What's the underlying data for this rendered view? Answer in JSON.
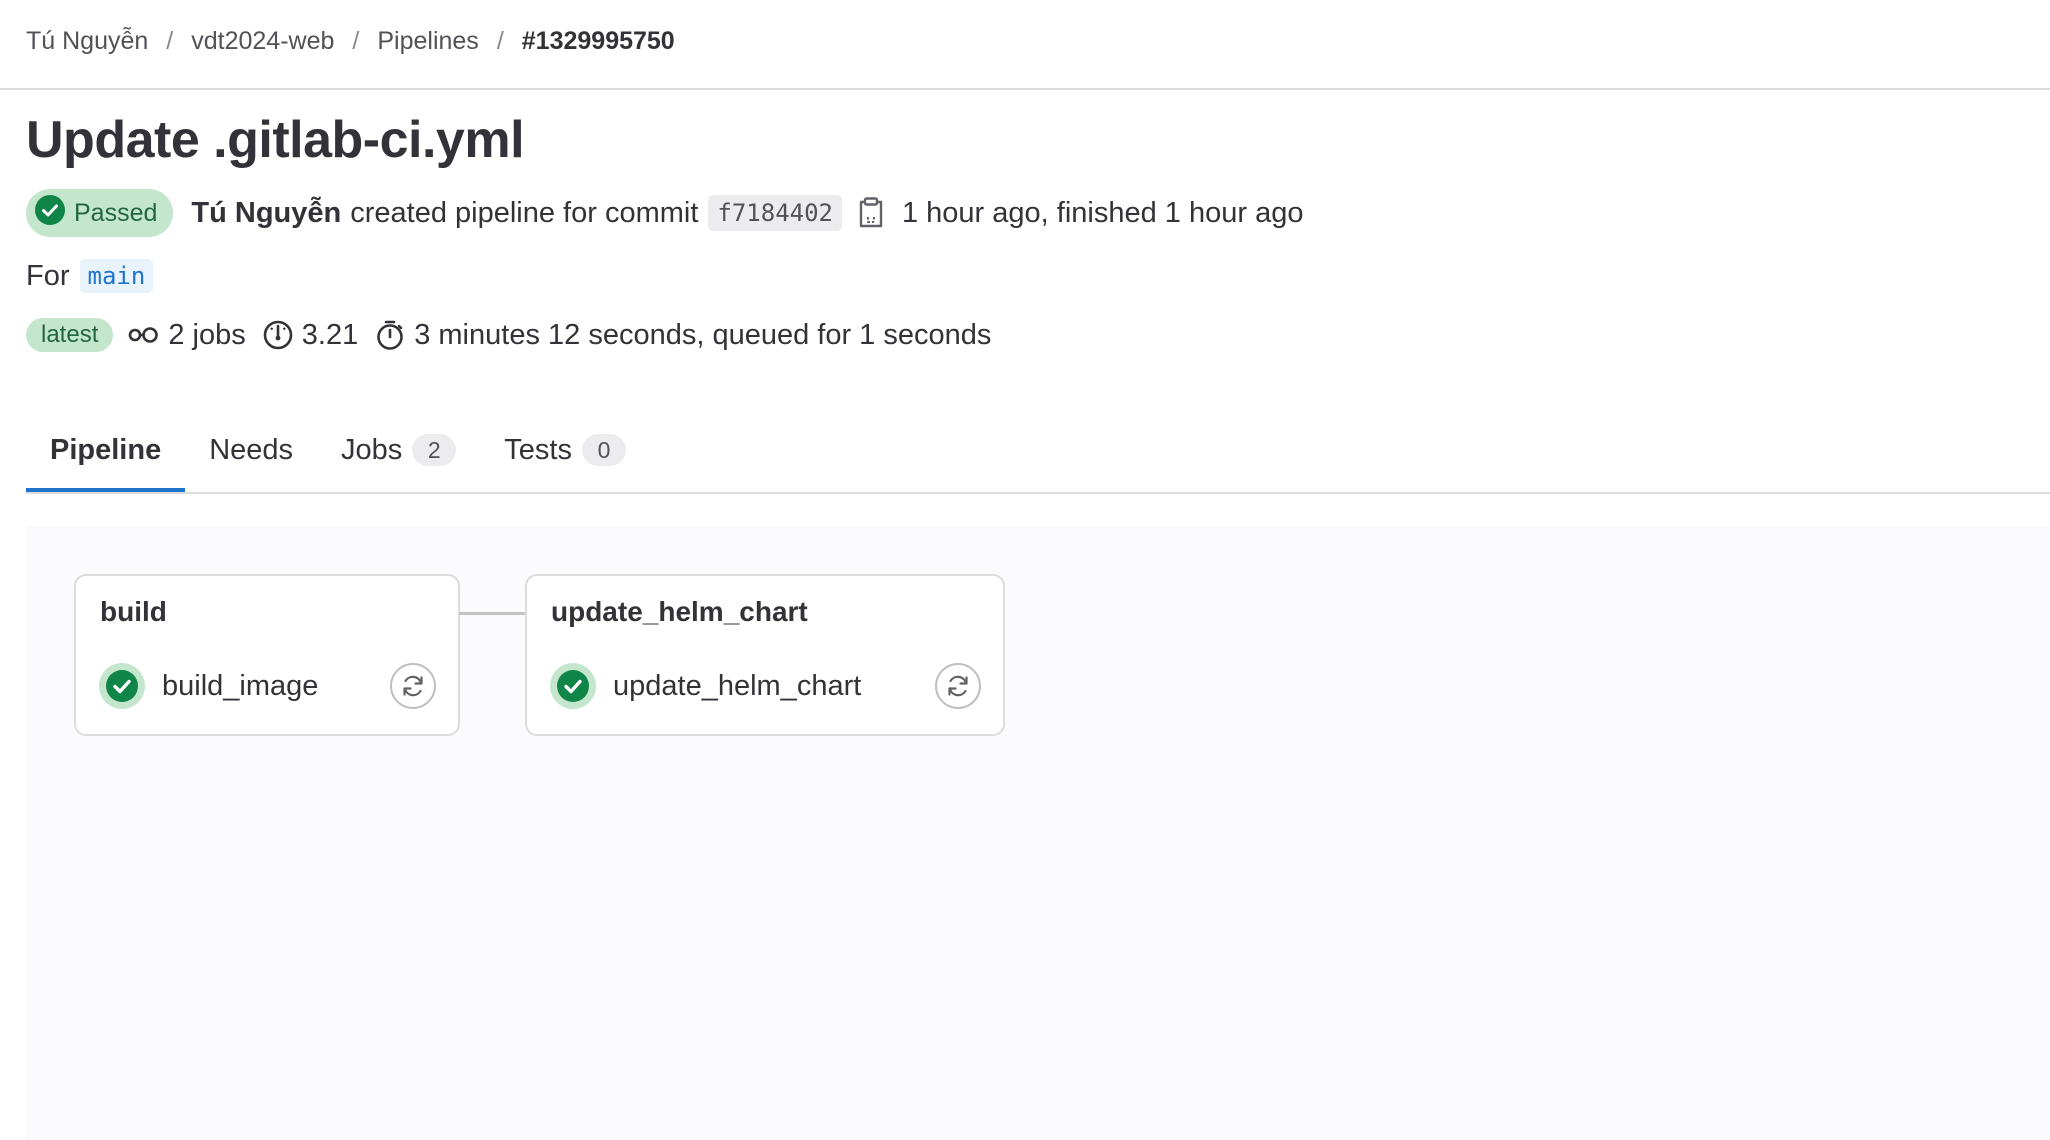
{
  "breadcrumb": {
    "items": [
      "Tú Nguyễn",
      "vdt2024-web",
      "Pipelines",
      "#1329995750"
    ],
    "separator": "/"
  },
  "title": "Update .gitlab-ci.yml",
  "status": {
    "label": "Passed",
    "icon": "check-circle-icon",
    "color": "#108548"
  },
  "author": "Tú Nguyễn",
  "created_text": "created pipeline for commit",
  "commit_sha": "f7184402",
  "time_text": "1 hour ago, finished 1 hour ago",
  "ref": {
    "label": "For",
    "branch": "main"
  },
  "meta": {
    "badge": "latest",
    "jobs": "2 jobs",
    "compute": "3.21",
    "duration": "3 minutes 12 seconds, queued for 1 seconds"
  },
  "tabs": [
    {
      "label": "Pipeline",
      "count": null,
      "active": true
    },
    {
      "label": "Needs",
      "count": null,
      "active": false
    },
    {
      "label": "Jobs",
      "count": "2",
      "active": false
    },
    {
      "label": "Tests",
      "count": "0",
      "active": false
    }
  ],
  "stages": [
    {
      "name": "build",
      "job": {
        "name": "build_image",
        "status": "success"
      }
    },
    {
      "name": "update_helm_chart",
      "job": {
        "name": "update_helm_chart",
        "status": "success"
      }
    }
  ],
  "colors": {
    "accent": "#1f75cb",
    "success": "#108548",
    "success_bg": "#c3e6cd"
  }
}
